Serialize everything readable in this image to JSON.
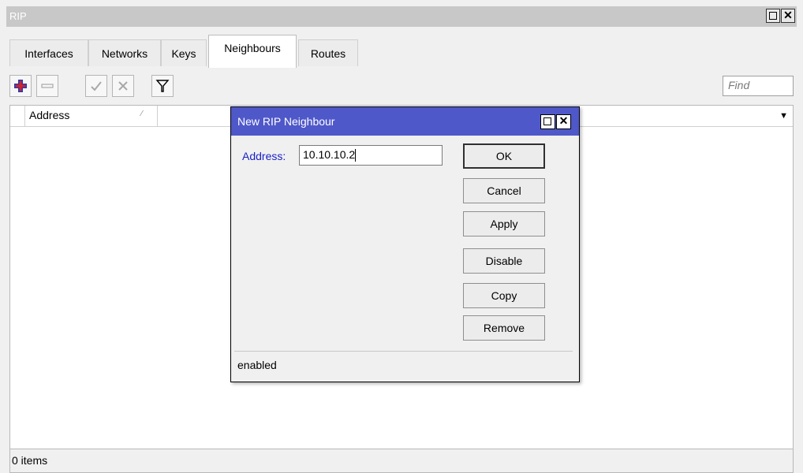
{
  "window": {
    "title": "RIP"
  },
  "tabs": [
    {
      "label": "Interfaces"
    },
    {
      "label": "Networks"
    },
    {
      "label": "Keys"
    },
    {
      "label": "Neighbours"
    },
    {
      "label": "Routes"
    }
  ],
  "active_tab": "Neighbours",
  "toolbar": {
    "icons": [
      "add-icon",
      "remove-icon",
      "enable-icon",
      "disable-icon",
      "filter-icon"
    ],
    "find_placeholder": "Find"
  },
  "table": {
    "columns": [
      {
        "label": "Address"
      }
    ],
    "rows": []
  },
  "status": {
    "count_text": "0 items"
  },
  "dialog": {
    "title": "New RIP Neighbour",
    "address_label": "Address:",
    "address_value": "10.10.10.2",
    "buttons": {
      "ok": "OK",
      "cancel": "Cancel",
      "apply": "Apply",
      "disable": "Disable",
      "copy": "Copy",
      "remove": "Remove"
    },
    "status_text": "enabled"
  },
  "colors": {
    "dialog_title_bg": "#4f58c9",
    "label_blue": "#1a21c8",
    "add_icon": "#1d3fb8"
  }
}
